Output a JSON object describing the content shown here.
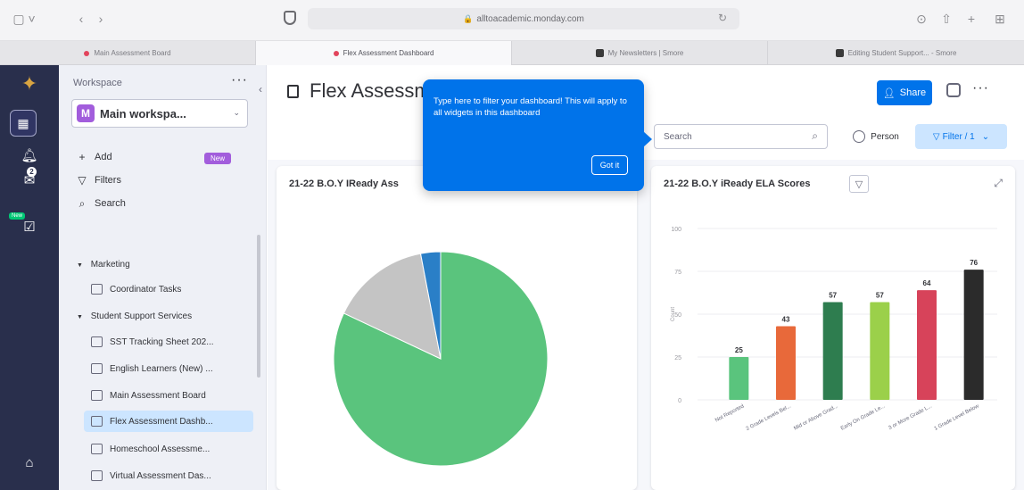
{
  "browser": {
    "url": "alltoacademic.monday.com",
    "tabs": [
      {
        "label": "Main Assessment Board",
        "active": false,
        "favicon": "monday-icon"
      },
      {
        "label": "Flex Assessment Dashboard",
        "active": true,
        "favicon": "monday-icon"
      },
      {
        "label": "My Newsletters | Smore",
        "active": false,
        "favicon": "smore-icon"
      },
      {
        "label": "Editing Student Support... - Smore",
        "active": false,
        "favicon": "smore-icon"
      }
    ]
  },
  "rail": {
    "new_badge": "New",
    "notification_count": "2"
  },
  "sidebar": {
    "workspace_label": "Workspace",
    "workspace_name": "Main workspa...",
    "workspace_initial": "M",
    "add_label": "Add",
    "new_pill": "New",
    "filters_label": "Filters",
    "search_label": "Search",
    "folders": [
      {
        "label": "Marketing"
      },
      {
        "label": "Student Support Services"
      }
    ],
    "items": [
      {
        "label": "Coordinator Tasks"
      },
      {
        "label": "SST Tracking Sheet 202..."
      },
      {
        "label": "English Learners (New) ..."
      },
      {
        "label": "Main Assessment Board"
      },
      {
        "label": "Flex Assessment Dashb..."
      },
      {
        "label": "Homeschool Assessme..."
      },
      {
        "label": "Virtual Assessment Das..."
      }
    ]
  },
  "main": {
    "title": "Flex Assessm",
    "share_label": "Share",
    "search_placeholder": "Search",
    "person_label": "Person",
    "filter_label": "Filter / 1",
    "tooltip": {
      "text": "Type here to filter your dashboard! This will apply to all widgets in this dashboard",
      "button": "Got it"
    },
    "widget_left_title": "21-22 B.O.Y IReady Ass",
    "widget_right_title": "21-22 B.O.Y iReady ELA Scores"
  },
  "colors": {
    "accent": "#0073ea",
    "rail": "#292f4c",
    "green": "#5ac47d",
    "grey": "#c4c4c4",
    "blue": "#2a7fc7"
  },
  "chart_data": [
    {
      "type": "pie",
      "title": "21-22 B.O.Y IReady Ass",
      "slices": [
        {
          "value": 82,
          "color": "#5ac47d"
        },
        {
          "value": 15,
          "color": "#c4c4c4"
        },
        {
          "value": 3,
          "color": "#2a7fc7"
        }
      ]
    },
    {
      "type": "bar",
      "title": "21-22 B.O.Y iReady ELA Scores",
      "categories": [
        "Not Reported",
        "2 Grade Levels Bel...",
        "Mid or Above Grad...",
        "Early On Grade Le...",
        "3 or More Grade L...",
        "1 Grade Level Below"
      ],
      "values": [
        25,
        43,
        57,
        57,
        64,
        76
      ],
      "colors": [
        "#5ac47d",
        "#e8693a",
        "#2e7d4f",
        "#9bd04a",
        "#d7435a",
        "#2b2b2b"
      ],
      "ylim": [
        0,
        100
      ],
      "yticks": [
        0,
        25,
        50,
        75,
        100
      ],
      "ylabel": "Count"
    }
  ]
}
